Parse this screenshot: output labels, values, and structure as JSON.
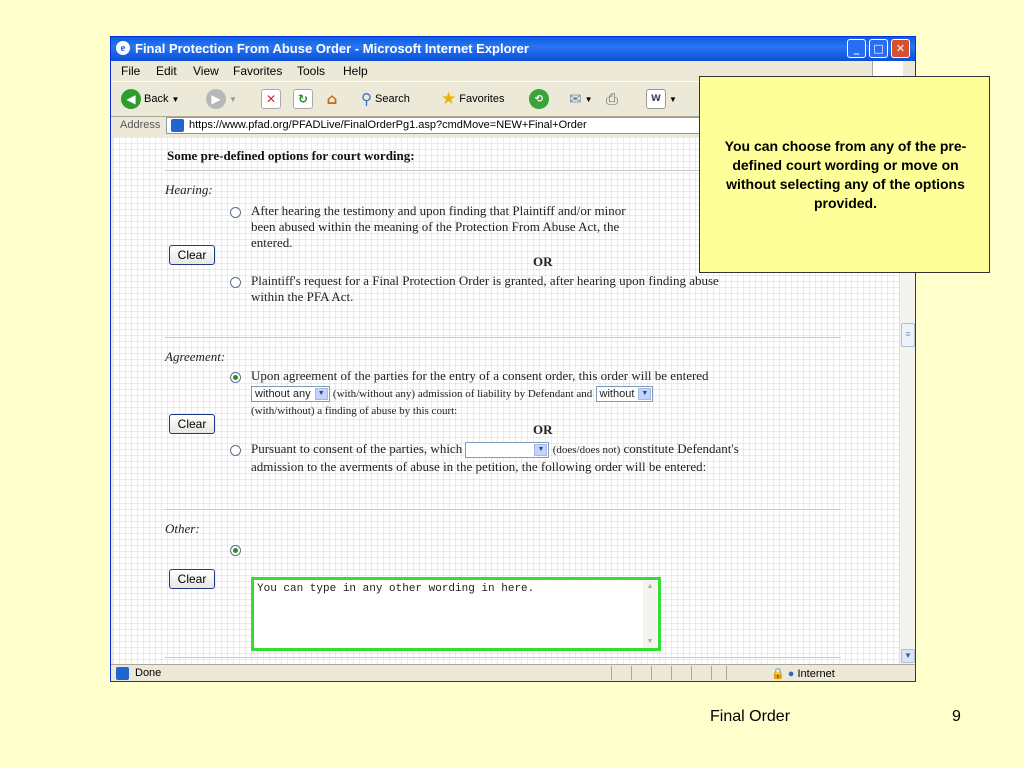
{
  "window": {
    "title": "Final Protection From Abuse Order - Microsoft Internet Explorer",
    "controls": {
      "minimize": "_",
      "maximize": "□",
      "close": "✕"
    }
  },
  "menu": [
    "File",
    "Edit",
    "View",
    "Favorites",
    "Tools",
    "Help"
  ],
  "toolbar": {
    "back": "Back",
    "search": "Search",
    "favorites": "Favorites"
  },
  "address": {
    "label": "Address",
    "url": "https://www.pfad.org/PFADLive/FinalOrderPg1.asp?cmdMove=NEW+Final+Order"
  },
  "page": {
    "heading": "Some pre-defined options for court wording:",
    "or_label": "OR",
    "clear_label": "Clear",
    "hearing": {
      "label": "Hearing:",
      "option1_line1": "After hearing the testimony and upon finding that Plaintiff and/or minor",
      "option1_line2": "been abused within the meaning of the Protection From Abuse Act, the",
      "option1_line3": "entered.",
      "option2_line1": "Plaintiff's request for a Final Protection Order is granted, after hearing upon finding abuse",
      "option2_line2": "within the PFA Act."
    },
    "agreement": {
      "label": "Agreement:",
      "option1_line1": "Upon agreement of the parties for the entry of a consent order, this order will be entered",
      "select1_value": "without any",
      "select1_hint": "(with/without any) admission of liability by Defendant and",
      "select2_value": "without",
      "option1_line3": "(with/without) a finding of abuse by this court:",
      "option2_prefix": "Pursuant to consent of the parties, which",
      "select3_value": "",
      "option2_hint": "(does/does not)",
      "option2_suffix": "constitute Defendant's",
      "option2_line2": "admission to the averments of abuse in the petition, the following order will be entered:"
    },
    "other": {
      "label": "Other:",
      "textarea_value": "You can type in any other wording in here."
    }
  },
  "status": {
    "text": "Done",
    "zone": "Internet"
  },
  "callout": {
    "text": "You can choose from any of the pre-defined court wording or move on without selecting any of the options provided."
  },
  "footer": {
    "title": "Final Order",
    "page_number": "9"
  }
}
